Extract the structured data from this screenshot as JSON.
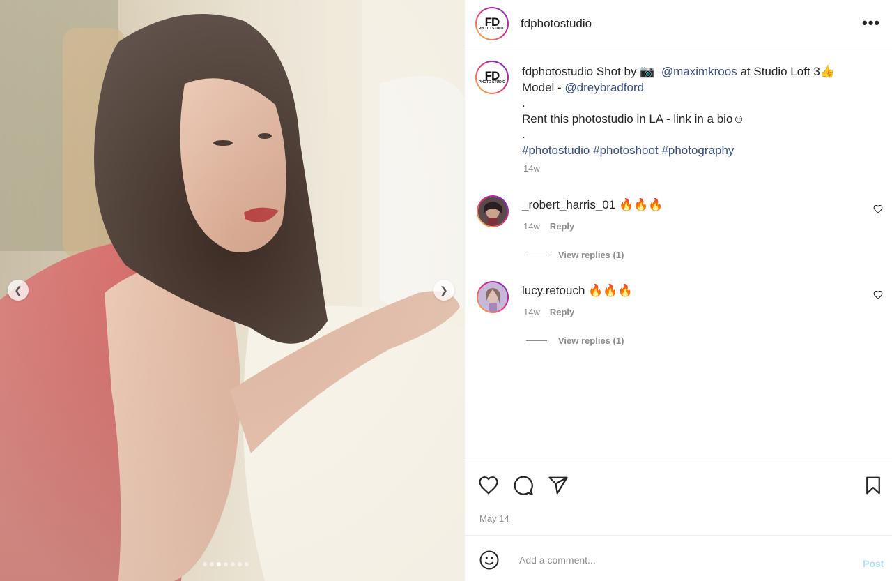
{
  "post": {
    "username": "fdphotostudio",
    "avatar_logo_main": "FD",
    "avatar_logo_sub": "PHOTO STUDIO",
    "carousel": {
      "total_slides": 7,
      "active_slide": 3
    }
  },
  "caption": {
    "username": "fdphotostudio",
    "text_shot_by": "Shot by 📷",
    "mention_1": "@maximkroos",
    "text_at": "at Studio Loft 3👍",
    "text_model": "Model -",
    "mention_2": "@dreybradford",
    "dot_1": ".",
    "line_rent": "Rent this photostudio in LA - link in a bio☺",
    "dot_2": ".",
    "hashtags": [
      "#photostudio",
      "#photoshoot",
      "#photography"
    ],
    "timestamp": "14w"
  },
  "comments": [
    {
      "username": "_robert_harris_01",
      "text": "🔥🔥🔥",
      "timestamp": "14w",
      "reply_label": "Reply",
      "view_replies": "View replies (1)"
    },
    {
      "username": "lucy.retouch",
      "text": "🔥🔥🔥",
      "timestamp": "14w",
      "reply_label": "Reply",
      "view_replies": "View replies (1)"
    }
  ],
  "footer": {
    "date": "May 14",
    "comment_placeholder": "Add a comment...",
    "post_label": "Post"
  },
  "icons": [
    "chevron-left-icon",
    "chevron-right-icon",
    "more-icon",
    "heart-icon",
    "comment-icon",
    "share-icon",
    "bookmark-icon",
    "emoji-icon"
  ],
  "colors": {
    "link": "#385185",
    "muted": "#8e8e8e",
    "post_disabled": "#b2dffc",
    "dress": "#c9504f"
  }
}
